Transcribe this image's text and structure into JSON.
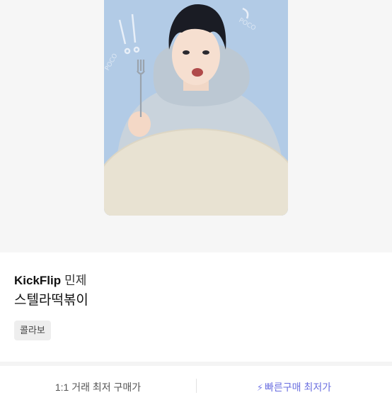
{
  "product": {
    "artist": "KickFlip",
    "member": "민제",
    "title": "스텔라떡볶이",
    "tag": "콜라보"
  },
  "price_bar": {
    "left_label": "1:1 거래 최저 구매가",
    "right_label": "빠른구매 최저가",
    "right_icon": "lightning-bolt-icon"
  },
  "colors": {
    "card_background": "#b2cbe6",
    "accent": "#6b6fe0",
    "page_background": "#f6f6f6"
  }
}
